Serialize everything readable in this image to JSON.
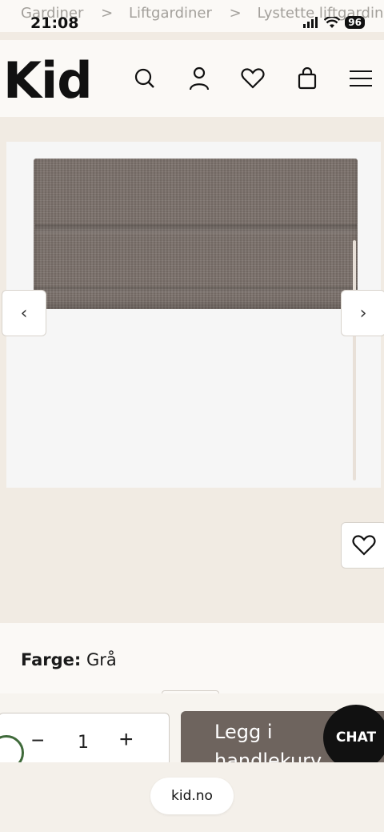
{
  "status_bar": {
    "time": "21:08",
    "battery": "96"
  },
  "breadcrumb": {
    "items": [
      "Gardiner",
      "Liftgardiner",
      "Lystette liftgardiner"
    ],
    "separator": ">"
  },
  "header": {
    "logo": "Kid"
  },
  "product": {
    "prev_arrow": "‹",
    "next_arrow": "›",
    "color_label": "Farge:",
    "color_value": "Grå"
  },
  "purchase": {
    "quantity": "1",
    "minus": "−",
    "plus": "+",
    "add_to_cart": "Legg i handlekurv"
  },
  "chat": {
    "label": "CHAT"
  },
  "browser": {
    "url": "kid.no"
  },
  "colors": {
    "background": "#f1ebe3",
    "cart_button": "#6e645e",
    "chat_button": "#111111"
  }
}
